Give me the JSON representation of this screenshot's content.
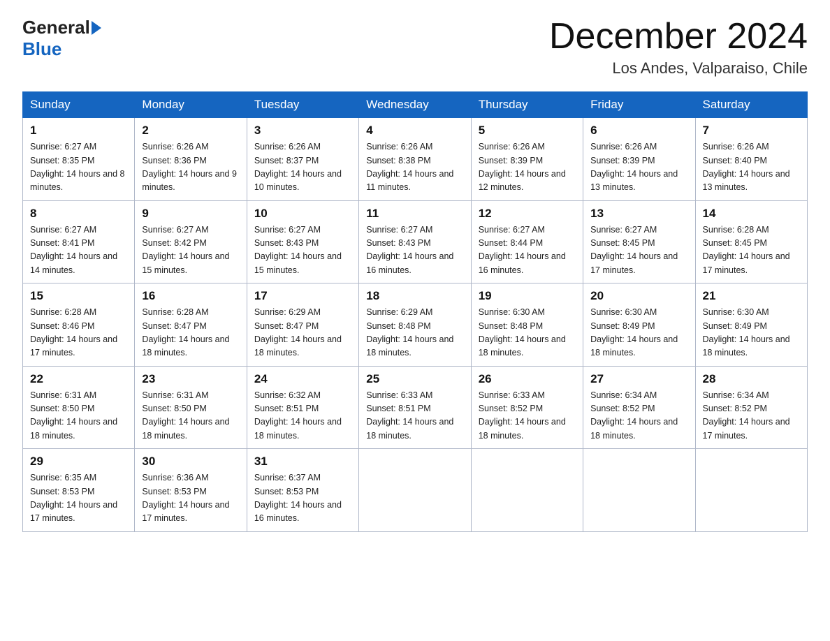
{
  "header": {
    "logo_general": "General",
    "logo_blue": "Blue",
    "month_title": "December 2024",
    "location": "Los Andes, Valparaiso, Chile"
  },
  "weekdays": [
    "Sunday",
    "Monday",
    "Tuesday",
    "Wednesday",
    "Thursday",
    "Friday",
    "Saturday"
  ],
  "weeks": [
    [
      {
        "day": "1",
        "sunrise": "6:27 AM",
        "sunset": "8:35 PM",
        "daylight": "14 hours and 8 minutes."
      },
      {
        "day": "2",
        "sunrise": "6:26 AM",
        "sunset": "8:36 PM",
        "daylight": "14 hours and 9 minutes."
      },
      {
        "day": "3",
        "sunrise": "6:26 AM",
        "sunset": "8:37 PM",
        "daylight": "14 hours and 10 minutes."
      },
      {
        "day": "4",
        "sunrise": "6:26 AM",
        "sunset": "8:38 PM",
        "daylight": "14 hours and 11 minutes."
      },
      {
        "day": "5",
        "sunrise": "6:26 AM",
        "sunset": "8:39 PM",
        "daylight": "14 hours and 12 minutes."
      },
      {
        "day": "6",
        "sunrise": "6:26 AM",
        "sunset": "8:39 PM",
        "daylight": "14 hours and 13 minutes."
      },
      {
        "day": "7",
        "sunrise": "6:26 AM",
        "sunset": "8:40 PM",
        "daylight": "14 hours and 13 minutes."
      }
    ],
    [
      {
        "day": "8",
        "sunrise": "6:27 AM",
        "sunset": "8:41 PM",
        "daylight": "14 hours and 14 minutes."
      },
      {
        "day": "9",
        "sunrise": "6:27 AM",
        "sunset": "8:42 PM",
        "daylight": "14 hours and 15 minutes."
      },
      {
        "day": "10",
        "sunrise": "6:27 AM",
        "sunset": "8:43 PM",
        "daylight": "14 hours and 15 minutes."
      },
      {
        "day": "11",
        "sunrise": "6:27 AM",
        "sunset": "8:43 PM",
        "daylight": "14 hours and 16 minutes."
      },
      {
        "day": "12",
        "sunrise": "6:27 AM",
        "sunset": "8:44 PM",
        "daylight": "14 hours and 16 minutes."
      },
      {
        "day": "13",
        "sunrise": "6:27 AM",
        "sunset": "8:45 PM",
        "daylight": "14 hours and 17 minutes."
      },
      {
        "day": "14",
        "sunrise": "6:28 AM",
        "sunset": "8:45 PM",
        "daylight": "14 hours and 17 minutes."
      }
    ],
    [
      {
        "day": "15",
        "sunrise": "6:28 AM",
        "sunset": "8:46 PM",
        "daylight": "14 hours and 17 minutes."
      },
      {
        "day": "16",
        "sunrise": "6:28 AM",
        "sunset": "8:47 PM",
        "daylight": "14 hours and 18 minutes."
      },
      {
        "day": "17",
        "sunrise": "6:29 AM",
        "sunset": "8:47 PM",
        "daylight": "14 hours and 18 minutes."
      },
      {
        "day": "18",
        "sunrise": "6:29 AM",
        "sunset": "8:48 PM",
        "daylight": "14 hours and 18 minutes."
      },
      {
        "day": "19",
        "sunrise": "6:30 AM",
        "sunset": "8:48 PM",
        "daylight": "14 hours and 18 minutes."
      },
      {
        "day": "20",
        "sunrise": "6:30 AM",
        "sunset": "8:49 PM",
        "daylight": "14 hours and 18 minutes."
      },
      {
        "day": "21",
        "sunrise": "6:30 AM",
        "sunset": "8:49 PM",
        "daylight": "14 hours and 18 minutes."
      }
    ],
    [
      {
        "day": "22",
        "sunrise": "6:31 AM",
        "sunset": "8:50 PM",
        "daylight": "14 hours and 18 minutes."
      },
      {
        "day": "23",
        "sunrise": "6:31 AM",
        "sunset": "8:50 PM",
        "daylight": "14 hours and 18 minutes."
      },
      {
        "day": "24",
        "sunrise": "6:32 AM",
        "sunset": "8:51 PM",
        "daylight": "14 hours and 18 minutes."
      },
      {
        "day": "25",
        "sunrise": "6:33 AM",
        "sunset": "8:51 PM",
        "daylight": "14 hours and 18 minutes."
      },
      {
        "day": "26",
        "sunrise": "6:33 AM",
        "sunset": "8:52 PM",
        "daylight": "14 hours and 18 minutes."
      },
      {
        "day": "27",
        "sunrise": "6:34 AM",
        "sunset": "8:52 PM",
        "daylight": "14 hours and 18 minutes."
      },
      {
        "day": "28",
        "sunrise": "6:34 AM",
        "sunset": "8:52 PM",
        "daylight": "14 hours and 17 minutes."
      }
    ],
    [
      {
        "day": "29",
        "sunrise": "6:35 AM",
        "sunset": "8:53 PM",
        "daylight": "14 hours and 17 minutes."
      },
      {
        "day": "30",
        "sunrise": "6:36 AM",
        "sunset": "8:53 PM",
        "daylight": "14 hours and 17 minutes."
      },
      {
        "day": "31",
        "sunrise": "6:37 AM",
        "sunset": "8:53 PM",
        "daylight": "14 hours and 16 minutes."
      },
      null,
      null,
      null,
      null
    ]
  ]
}
